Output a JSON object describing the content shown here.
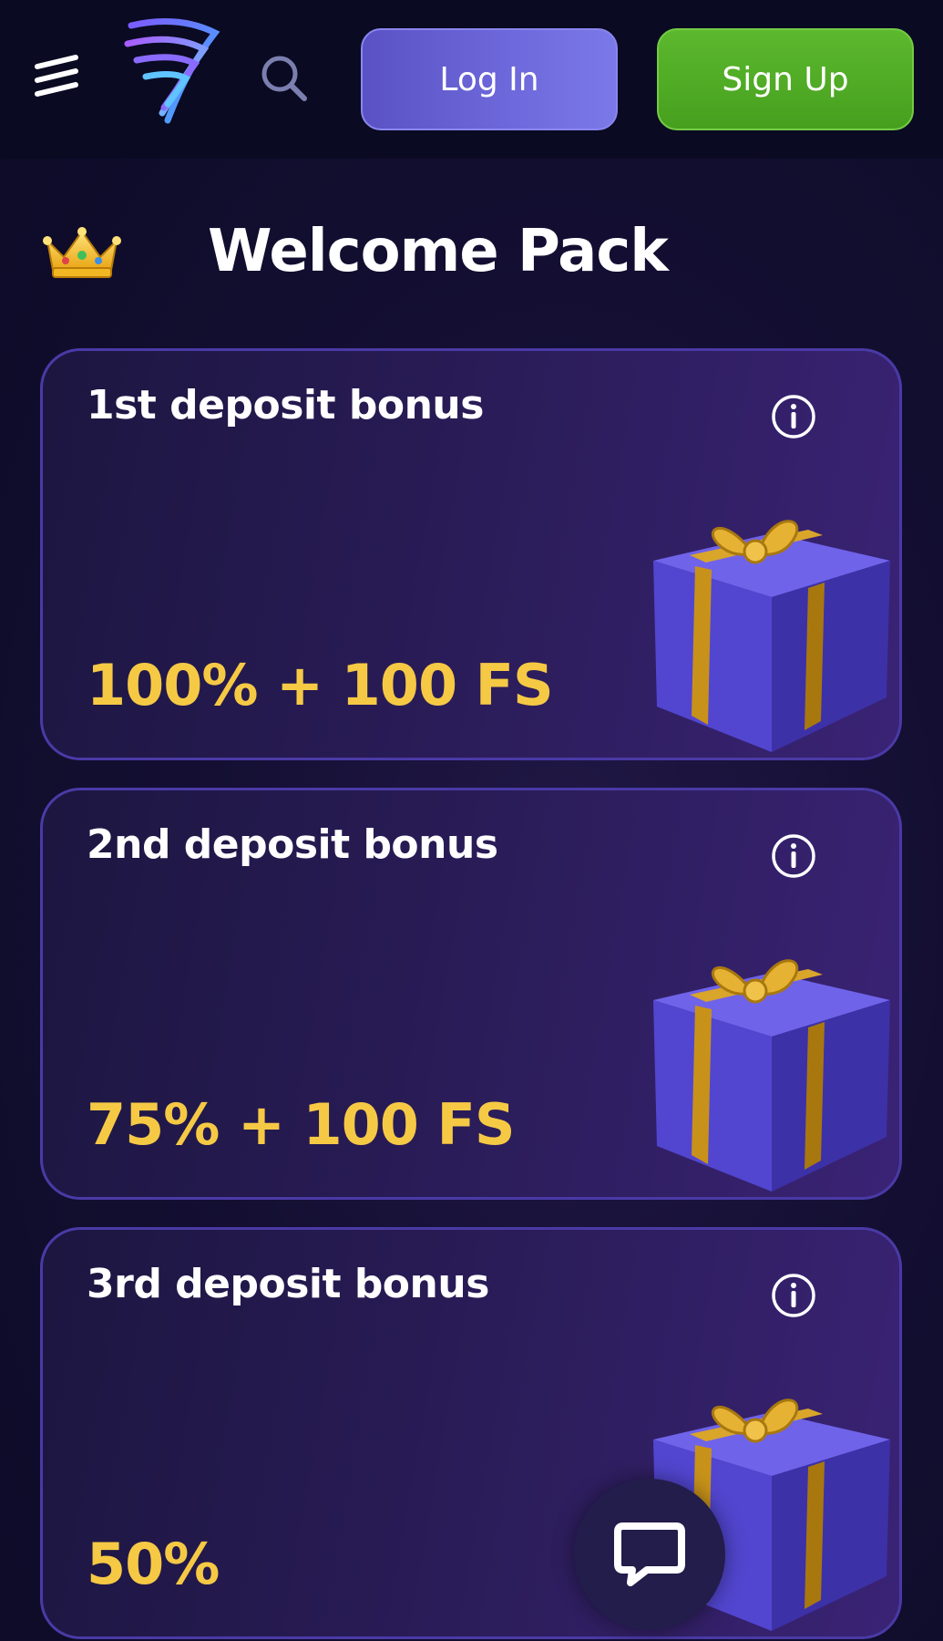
{
  "header": {
    "login_label": "Log In",
    "signup_label": "Sign Up",
    "icons": {
      "menu": "menu-icon",
      "logo": "brand-logo",
      "search": "search-icon"
    }
  },
  "welcome": {
    "title": "Welcome Pack",
    "icon": "crown-icon"
  },
  "bonuses": [
    {
      "title": "1st deposit bonus",
      "value": "100% + 100 FS",
      "icon": "gift-icon"
    },
    {
      "title": "2nd deposit bonus",
      "value": "75% + 100 FS",
      "icon": "gift-icon"
    },
    {
      "title": "3rd deposit bonus",
      "value": "50%",
      "icon": "gift-icon"
    }
  ],
  "chat": {
    "icon": "chat-bubble-icon"
  },
  "colors": {
    "background": "#0b0b24",
    "header": "#0a0a22",
    "login": "#6e69dc",
    "signup": "#4ea824",
    "bonus_value": "#f6c945",
    "card_border": "#4a3aa6"
  }
}
